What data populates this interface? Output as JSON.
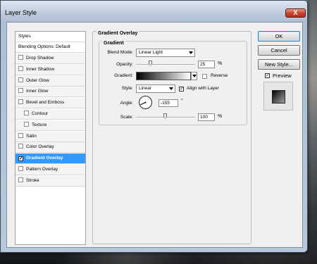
{
  "window": {
    "title": "Layer Style",
    "close_glyph": "X"
  },
  "styles_list": {
    "header": "Styles",
    "blending_options": "Blending Options: Default",
    "items": [
      {
        "label": "Drop Shadow",
        "checked": false,
        "indent": false
      },
      {
        "label": "Inner Shadow",
        "checked": false,
        "indent": false
      },
      {
        "label": "Outer Glow",
        "checked": false,
        "indent": false
      },
      {
        "label": "Inner Glow",
        "checked": false,
        "indent": false
      },
      {
        "label": "Bevel and Emboss",
        "checked": false,
        "indent": false
      },
      {
        "label": "Contour",
        "checked": false,
        "indent": true
      },
      {
        "label": "Texture",
        "checked": false,
        "indent": true
      },
      {
        "label": "Satin",
        "checked": false,
        "indent": false
      },
      {
        "label": "Color Overlay",
        "checked": false,
        "indent": false
      },
      {
        "label": "Gradient Overlay",
        "checked": true,
        "indent": false,
        "selected": true
      },
      {
        "label": "Pattern Overlay",
        "checked": false,
        "indent": false
      },
      {
        "label": "Stroke",
        "checked": false,
        "indent": false
      }
    ]
  },
  "panel": {
    "title": "Gradient Overlay",
    "section": "Gradient",
    "blend_mode_label": "Blend Mode:",
    "blend_mode_value": "Linear Light",
    "opacity_label": "Opacity:",
    "opacity_value": "25",
    "opacity_unit": "%",
    "opacity_level": 0.25,
    "gradient_label": "Gradient:",
    "reverse_label": "Reverse",
    "reverse_checked": false,
    "style_label": "Style:",
    "style_value": "Linear",
    "align_label": "Align with Layer",
    "align_checked": true,
    "angle_label": "Angle:",
    "angle_value": "-155",
    "angle_unit": "°",
    "scale_label": "Scale:",
    "scale_value": "100",
    "scale_unit": "%",
    "scale_level": 0.5
  },
  "buttons": {
    "ok": "OK",
    "cancel": "Cancel",
    "new_style": "New Style...",
    "preview_label": "Preview",
    "preview_checked": true
  }
}
